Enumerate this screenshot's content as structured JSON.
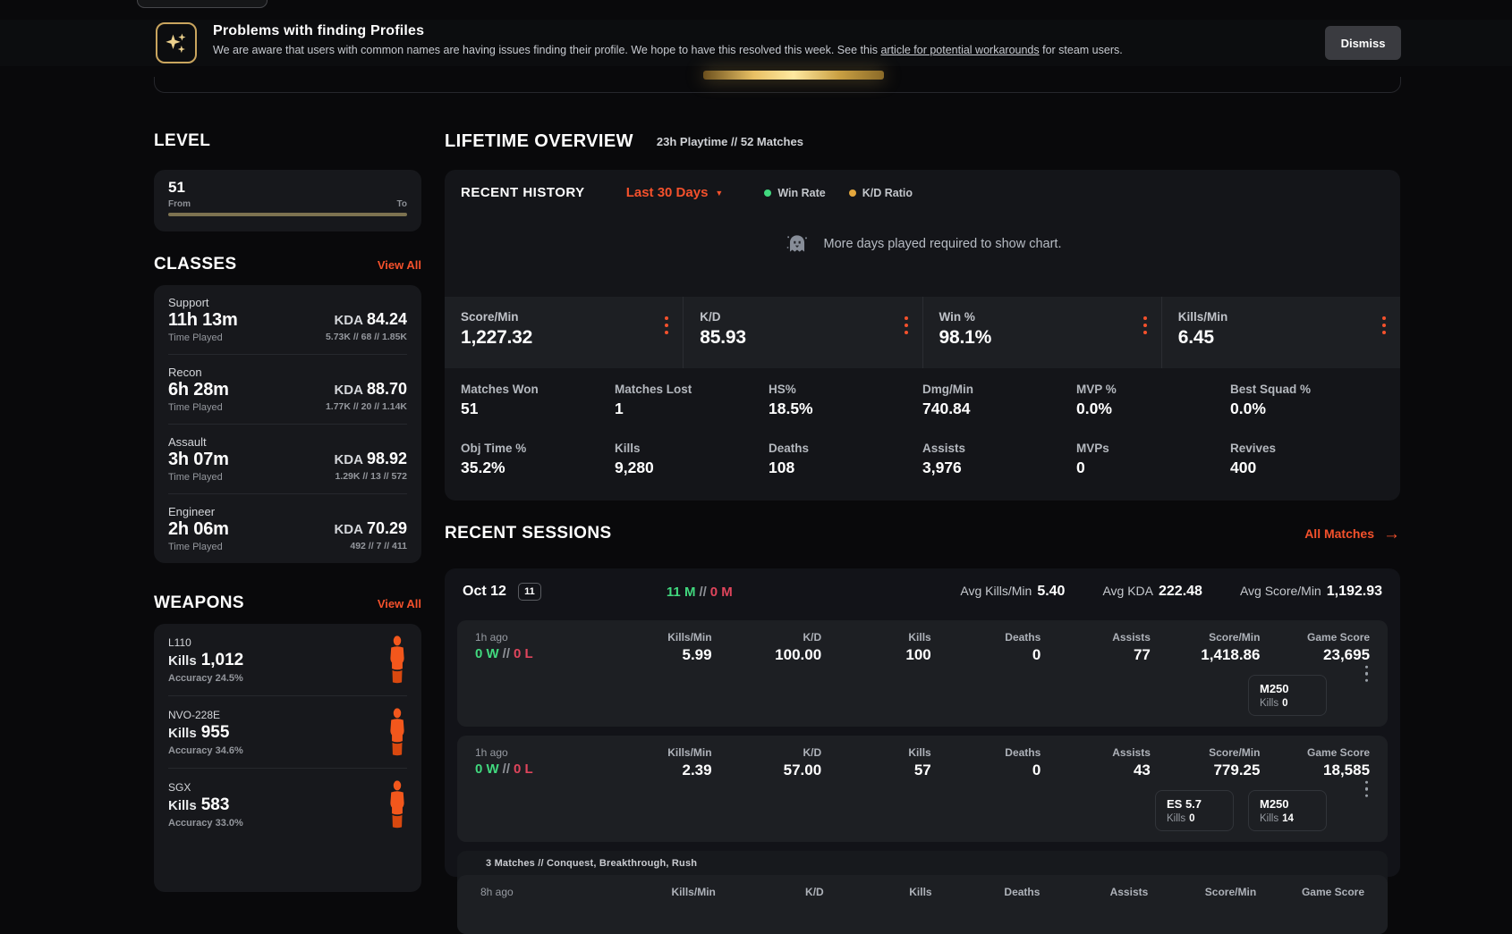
{
  "colors": {
    "accent": "#f4512c",
    "win": "#41d87e",
    "loss": "#e0455c",
    "legend_win": "#41d87e",
    "legend_kd": "#e3a63c",
    "gold": "#e8c064"
  },
  "banner": {
    "title": "Problems with finding Profiles",
    "text_before_link": "We are aware that users with common names are having issues finding their profile. We hope to have this resolved this week. See this ",
    "link_text": "article for potential workarounds",
    "text_after_link": " for steam users.",
    "dismiss_label": "Dismiss"
  },
  "level": {
    "heading": "LEVEL",
    "value": "51",
    "from_label": "From",
    "to_label": "To"
  },
  "classes": {
    "heading": "CLASSES",
    "view_all": "View All",
    "items": [
      {
        "name": "Support",
        "time": "11h 13m",
        "time_label": "Time Played",
        "kda_label": "KDA",
        "kda": "84.24",
        "detail": "5.73K // 68 // 1.85K"
      },
      {
        "name": "Recon",
        "time": "6h 28m",
        "time_label": "Time Played",
        "kda_label": "KDA",
        "kda": "88.70",
        "detail": "1.77K // 20 // 1.14K"
      },
      {
        "name": "Assault",
        "time": "3h 07m",
        "time_label": "Time Played",
        "kda_label": "KDA",
        "kda": "98.92",
        "detail": "1.29K // 13 // 572"
      },
      {
        "name": "Engineer",
        "time": "2h 06m",
        "time_label": "Time Played",
        "kda_label": "KDA",
        "kda": "70.29",
        "detail": "492 // 7 // 411"
      }
    ]
  },
  "weapons": {
    "heading": "WEAPONS",
    "view_all": "View All",
    "items": [
      {
        "name": "L110",
        "kills_label": "Kills",
        "kills": "1,012",
        "accuracy": "Accuracy 24.5%"
      },
      {
        "name": "NVO-228E",
        "kills_label": "Kills",
        "kills": "955",
        "accuracy": "Accuracy 34.6%"
      },
      {
        "name": "SGX",
        "kills_label": "Kills",
        "kills": "583",
        "accuracy": "Accuracy 33.0%"
      }
    ]
  },
  "overview": {
    "heading": "LIFETIME OVERVIEW",
    "subtitle": "23h Playtime // 52 Matches",
    "history_label": "RECENT HISTORY",
    "range_label": "Last 30 Days",
    "legend": [
      {
        "label": "Win Rate"
      },
      {
        "label": "K/D Ratio"
      }
    ],
    "empty_message": "More days played required to show chart.",
    "primary_stats": [
      {
        "label": "Score/Min",
        "value": "1,227.32"
      },
      {
        "label": "K/D",
        "value": "85.93"
      },
      {
        "label": "Win %",
        "value": "98.1%"
      },
      {
        "label": "Kills/Min",
        "value": "6.45"
      }
    ],
    "secondary_stats": [
      {
        "label": "Matches Won",
        "value": "51"
      },
      {
        "label": "Matches Lost",
        "value": "1"
      },
      {
        "label": "HS%",
        "value": "18.5%"
      },
      {
        "label": "Dmg/Min",
        "value": "740.84"
      },
      {
        "label": "MVP %",
        "value": "0.0%"
      },
      {
        "label": "Best Squad %",
        "value": "0.0%"
      },
      {
        "label": "Obj Time %",
        "value": "35.2%"
      },
      {
        "label": "Kills",
        "value": "9,280"
      },
      {
        "label": "Deaths",
        "value": "108"
      },
      {
        "label": "Assists",
        "value": "3,976"
      },
      {
        "label": "MVPs",
        "value": "0"
      },
      {
        "label": "Revives",
        "value": "400"
      }
    ]
  },
  "sessions": {
    "heading": "RECENT SESSIONS",
    "all_matches": "All Matches",
    "date": "Oct 12",
    "match_count": "11",
    "result": {
      "wins": "11 M",
      "sep": "//",
      "losses": "0 M"
    },
    "aggregates": [
      {
        "label": "Avg Kills/Min",
        "value": "5.40"
      },
      {
        "label": "Avg KDA",
        "value": "222.48"
      },
      {
        "label": "Avg Score/Min",
        "value": "1,192.93"
      }
    ],
    "matches": [
      {
        "ago": "1h ago",
        "wins": "0 W",
        "sep": "//",
        "losses": "0 L",
        "stats": [
          {
            "label": "Kills/Min",
            "value": "5.99"
          },
          {
            "label": "K/D",
            "value": "100.00"
          },
          {
            "label": "Kills",
            "value": "100"
          },
          {
            "label": "Deaths",
            "value": "0"
          },
          {
            "label": "Assists",
            "value": "77"
          },
          {
            "label": "Score/Min",
            "value": "1,418.86"
          },
          {
            "label": "Game Score",
            "value": "23,695"
          }
        ],
        "weapons": [
          {
            "name": "M250",
            "kills_label": "Kills",
            "kills": "0"
          }
        ]
      },
      {
        "ago": "1h ago",
        "wins": "0 W",
        "sep": "//",
        "losses": "0 L",
        "stats": [
          {
            "label": "Kills/Min",
            "value": "2.39"
          },
          {
            "label": "K/D",
            "value": "57.00"
          },
          {
            "label": "Kills",
            "value": "57"
          },
          {
            "label": "Deaths",
            "value": "0"
          },
          {
            "label": "Assists",
            "value": "43"
          },
          {
            "label": "Score/Min",
            "value": "779.25"
          },
          {
            "label": "Game Score",
            "value": "18,585"
          }
        ],
        "weapons": [
          {
            "name": "ES 5.7",
            "kills_label": "Kills",
            "kills": "0"
          },
          {
            "name": "M250",
            "kills_label": "Kills",
            "kills": "14"
          }
        ]
      }
    ],
    "group": {
      "label": "3 Matches // Conquest, Breakthrough, Rush",
      "ago": "8h ago",
      "headers": [
        "Kills/Min",
        "K/D",
        "Kills",
        "Deaths",
        "Assists",
        "Score/Min",
        "Game Score"
      ]
    }
  }
}
